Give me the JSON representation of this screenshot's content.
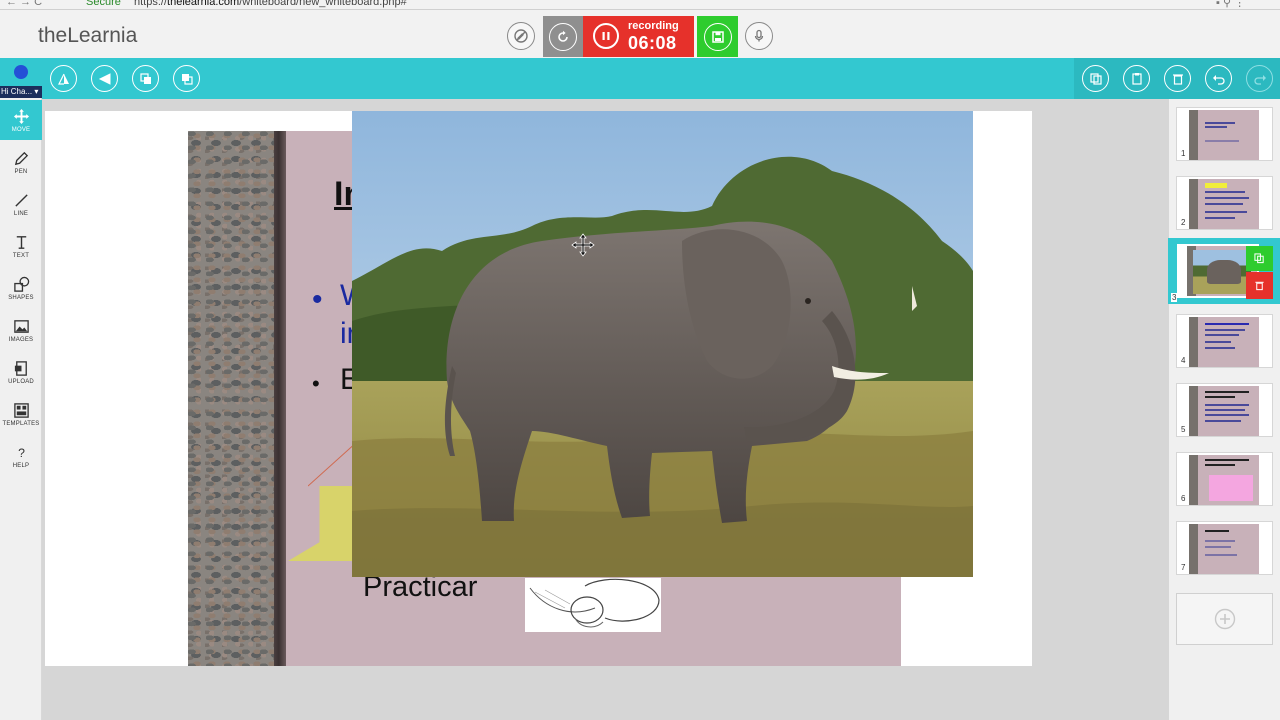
{
  "browser": {
    "secure_label": "Secure",
    "url_scheme": "https://",
    "url_host": "thelearnia.com",
    "url_path": "/whiteboard/new_whiteboard.php#"
  },
  "header": {
    "brand": "theLearnia",
    "recording": {
      "label": "recording",
      "time": "06:08"
    }
  },
  "left_toolbar": {
    "font_picker": "Hi Cha...",
    "tools": [
      {
        "id": "move",
        "label": "MOVE",
        "icon": "move-icon",
        "active": true
      },
      {
        "id": "pen",
        "label": "PEN",
        "icon": "pen-icon"
      },
      {
        "id": "line",
        "label": "LINE",
        "icon": "line-icon"
      },
      {
        "id": "text",
        "label": "TEXT",
        "icon": "text-icon"
      },
      {
        "id": "shapes",
        "label": "SHAPES",
        "icon": "shapes-icon"
      },
      {
        "id": "images",
        "label": "IMAGES",
        "icon": "image-icon"
      },
      {
        "id": "upload",
        "label": "UPLOAD",
        "icon": "upload-icon"
      },
      {
        "id": "templates",
        "label": "TEMPLATES",
        "icon": "templates-icon"
      },
      {
        "id": "help",
        "label": "HELP",
        "icon": "help-icon"
      }
    ]
  },
  "slide": {
    "title_partial": "In",
    "bullet_1_partial": "W",
    "bullet_1_line2_partial": "in",
    "bullet_2_partial": "E",
    "caption": "Practicar"
  },
  "slides_panel": {
    "numbers": [
      "1",
      "2",
      "3",
      "4",
      "5",
      "6",
      "7"
    ],
    "active": "3",
    "add_icon": "plus-icon"
  },
  "colors": {
    "accent": "#33c8d0",
    "recording": "#e6312b",
    "save": "#2ecc2e",
    "selected_pen": "#2450d6"
  }
}
